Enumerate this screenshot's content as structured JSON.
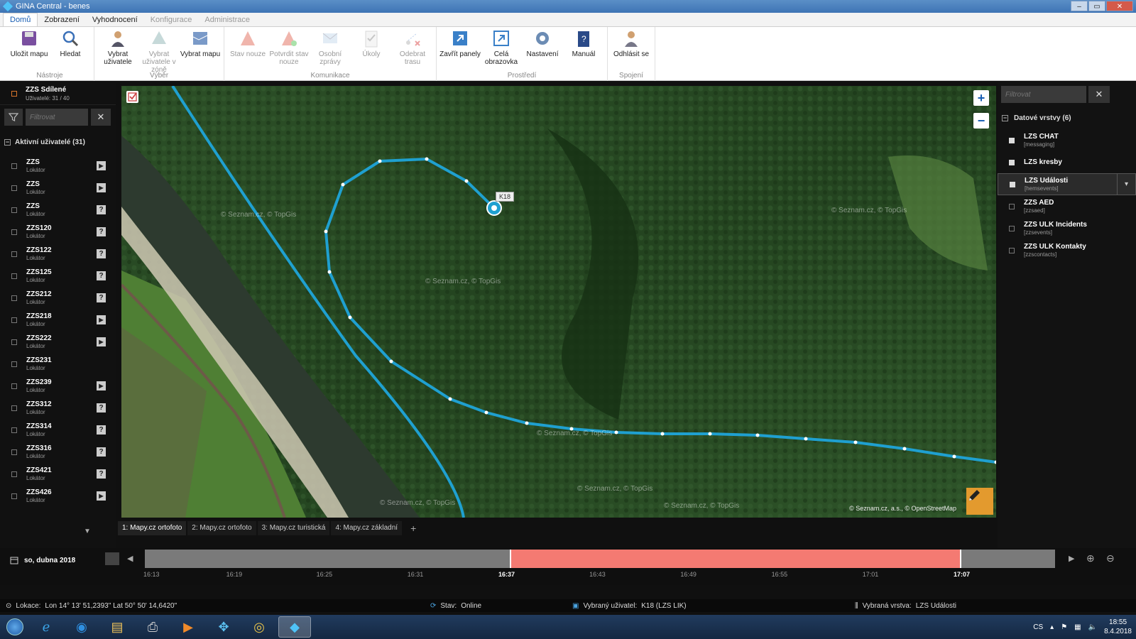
{
  "window": {
    "title": "GINA Central  - benes"
  },
  "menu": {
    "tabs": [
      {
        "label": "Domů",
        "state": "active"
      },
      {
        "label": "Zobrazení",
        "state": "normal"
      },
      {
        "label": "Vyhodnocení",
        "state": "normal"
      },
      {
        "label": "Konfigurace",
        "state": "disabled"
      },
      {
        "label": "Administrace",
        "state": "disabled"
      }
    ]
  },
  "ribbon": {
    "groups": [
      {
        "name": "Nástroje",
        "buttons": [
          {
            "label": "Uložit mapu",
            "icon": "save-map-icon",
            "enabled": true
          },
          {
            "label": "Hledat",
            "icon": "search-icon",
            "enabled": true
          }
        ]
      },
      {
        "name": "Výběr",
        "buttons": [
          {
            "label": "Vybrat uživatele",
            "icon": "select-user-icon",
            "enabled": true
          },
          {
            "label": "Vybrat uživatele v zóně",
            "icon": "select-zone-icon",
            "enabled": false
          },
          {
            "label": "Vybrat mapu",
            "icon": "select-map-icon",
            "enabled": true
          }
        ]
      },
      {
        "name": "Komunikace",
        "buttons": [
          {
            "label": "Stav nouze",
            "icon": "emergency-icon",
            "enabled": false
          },
          {
            "label": "Potvrdit stav nouze",
            "icon": "confirm-emergency-icon",
            "enabled": false
          },
          {
            "label": "Osobní zprávy",
            "icon": "mail-icon",
            "enabled": false
          },
          {
            "label": "Úkoly",
            "icon": "tasks-icon",
            "enabled": false
          },
          {
            "label": "Odebrat trasu",
            "icon": "remove-route-icon",
            "enabled": false
          }
        ]
      },
      {
        "name": "Prostředí",
        "buttons": [
          {
            "label": "Zavřít panely",
            "icon": "close-panels-icon",
            "enabled": true
          },
          {
            "label": "Celá obrazovka",
            "icon": "fullscreen-icon",
            "enabled": true
          },
          {
            "label": "Nastavení",
            "icon": "settings-icon",
            "enabled": true
          },
          {
            "label": "Manuál",
            "icon": "manual-icon",
            "enabled": true
          }
        ]
      },
      {
        "name": "Spojení",
        "buttons": [
          {
            "label": "Odhlásit se",
            "icon": "logout-icon",
            "enabled": true
          }
        ]
      }
    ]
  },
  "sidebar": {
    "shared": {
      "title": "ZZS Sdílené",
      "subtitle": "Uživatelé: 31 / 40"
    },
    "filter_placeholder": "Filtrovat",
    "group_label": "Aktivní uživatelé (31)",
    "users": [
      {
        "name": "ZZS",
        "sub": "Lokátor",
        "action": "play"
      },
      {
        "name": "ZZS",
        "sub": "Lokátor",
        "action": "play"
      },
      {
        "name": "ZZS",
        "sub": "Lokátor",
        "action": "help"
      },
      {
        "name": "ZZS120",
        "sub": "Lokátor",
        "action": "help"
      },
      {
        "name": "ZZS122",
        "sub": "Lokátor",
        "action": "help"
      },
      {
        "name": "ZZS125",
        "sub": "Lokátor",
        "action": "help"
      },
      {
        "name": "ZZS212",
        "sub": "Lokátor",
        "action": "help"
      },
      {
        "name": "ZZS218",
        "sub": "Lokátor",
        "action": "play"
      },
      {
        "name": "ZZS222",
        "sub": "Lokátor",
        "action": "play"
      },
      {
        "name": "ZZS231",
        "sub": "Lokátor",
        "action": "none"
      },
      {
        "name": "ZZS239",
        "sub": "Lokátor",
        "action": "play"
      },
      {
        "name": "ZZS312",
        "sub": "Lokátor",
        "action": "help"
      },
      {
        "name": "ZZS314",
        "sub": "Lokátor",
        "action": "help"
      },
      {
        "name": "ZZS316",
        "sub": "Lokátor",
        "action": "help"
      },
      {
        "name": "ZZS421",
        "sub": "Lokátor",
        "action": "help"
      },
      {
        "name": "ZZS426",
        "sub": "Lokátor",
        "action": "play"
      }
    ]
  },
  "map": {
    "marker_label": "K18",
    "watermark": "© Seznam.cz, © TopGis",
    "copyright": "© Seznam.cz, a.s., © OpenStreetMap",
    "tabs": [
      {
        "label": "1: Mapy.cz ortofoto",
        "active": true
      },
      {
        "label": "2: Mapy.cz ortofoto",
        "active": false
      },
      {
        "label": "3: Mapy.cz turistická",
        "active": false
      },
      {
        "label": "4: Mapy.cz základní",
        "active": false
      }
    ],
    "add_tab": "+"
  },
  "layers": {
    "filter_placeholder": "Filtrovat",
    "group_label": "Datové vrstvy (6)",
    "items": [
      {
        "name": "LZS CHAT",
        "sub": "[messaging]",
        "checked": true,
        "selected": false
      },
      {
        "name": "LZS kresby",
        "sub": "",
        "checked": true,
        "selected": false
      },
      {
        "name": "LZS Události",
        "sub": "[hemsevents]",
        "checked": true,
        "selected": true
      },
      {
        "name": "ZZS AED",
        "sub": "[zzsaed]",
        "checked": false,
        "selected": false
      },
      {
        "name": "ZZS ULK Incidents",
        "sub": "[zzsevents]",
        "checked": false,
        "selected": false
      },
      {
        "name": "ZZS ULK Kontakty",
        "sub": "[zzscontacts]",
        "checked": false,
        "selected": false
      }
    ]
  },
  "timeline": {
    "date": "so, dubna 2018",
    "ticks": [
      {
        "label": "16:13",
        "frac": 0.0,
        "bold": false
      },
      {
        "label": "16:19",
        "frac": 0.091,
        "bold": false
      },
      {
        "label": "16:25",
        "frac": 0.19,
        "bold": false
      },
      {
        "label": "16:31",
        "frac": 0.29,
        "bold": false
      },
      {
        "label": "16:37",
        "frac": 0.39,
        "bold": true
      },
      {
        "label": "16:43",
        "frac": 0.49,
        "bold": false
      },
      {
        "label": "16:49",
        "frac": 0.59,
        "bold": false
      },
      {
        "label": "16:55",
        "frac": 0.69,
        "bold": false
      },
      {
        "label": "17:01",
        "frac": 0.79,
        "bold": false
      },
      {
        "label": "17:07",
        "frac": 0.89,
        "bold": true
      }
    ],
    "selection_start": 0.401,
    "selection_end": 0.897
  },
  "status": {
    "location_label": "Lokace:",
    "location_value": "Lon 14° 13' 51,2393\"  Lat 50° 50' 14,6420\"",
    "state_label": "Stav:",
    "state_value": "Online",
    "user_label": "Vybraný uživatel:",
    "user_value": "K18 (LZS LIK)",
    "layer_label": "Vybraná vrstva:",
    "layer_value": "LZS Události"
  },
  "taskbar": {
    "apps": [
      "explorer-icon",
      "ie-icon",
      "skype-icon",
      "folder-icon",
      "printer-icon",
      "media-icon",
      "network-icon",
      "chrome-icon",
      "gina-icon"
    ],
    "lang": "CS",
    "time": "18:55",
    "date": "8.4.2018"
  },
  "colors": {
    "route": "#1fa0d0",
    "accent": "#1a5fb4",
    "timeline_selection": "#f47a72",
    "edit_button": "#e39a2e"
  }
}
